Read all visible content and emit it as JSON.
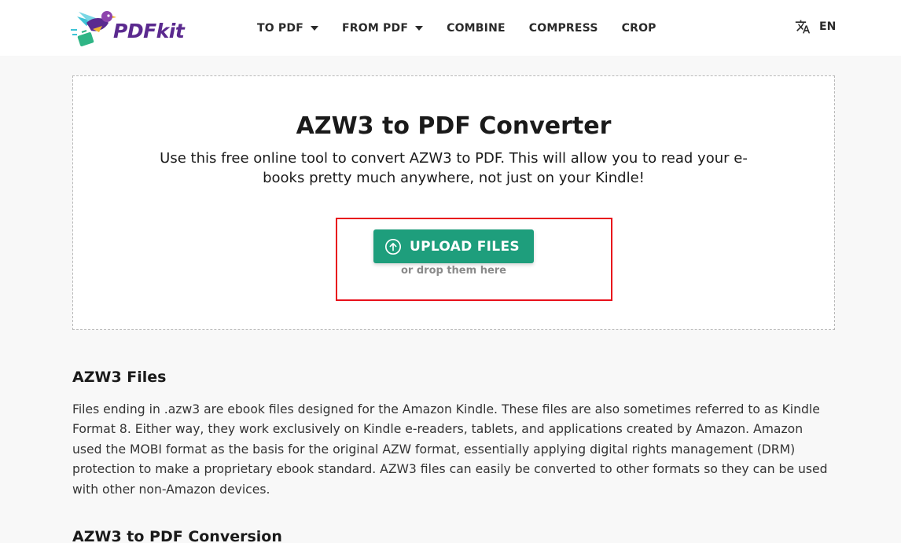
{
  "brand": {
    "name": "PDFkit"
  },
  "nav": {
    "items": [
      {
        "label": "TO PDF",
        "dropdown": true
      },
      {
        "label": "FROM PDF",
        "dropdown": true
      },
      {
        "label": "COMBINE",
        "dropdown": false
      },
      {
        "label": "COMPRESS",
        "dropdown": false
      },
      {
        "label": "CROP",
        "dropdown": false
      }
    ],
    "language": "EN"
  },
  "hero": {
    "title": "AZW3 to PDF Converter",
    "description": "Use this free online tool to convert AZW3 to PDF. This will allow you to read your e-books pretty much anywhere, not just on your Kindle!",
    "upload_label": "UPLOAD FILES",
    "drop_hint": "or drop them here"
  },
  "sections": [
    {
      "title": "AZW3 Files",
      "body": "Files ending in .azw3 are ebook files designed for the Amazon Kindle. These files are also sometimes referred to as Kindle Format 8. Either way, they work exclusively on Kindle e-readers, tablets, and applications created by Amazon. Amazon used the MOBI format as the basis for the original AZW format, essentially applying digital rights management (DRM) protection to make a proprietary ebook standard. AZW3 files can easily be converted to other formats so they can be used with other non-Amazon devices."
    },
    {
      "title": "AZW3 to PDF Conversion"
    }
  ],
  "colors": {
    "accent": "#1e9e7c",
    "brand": "#5b2a8f",
    "highlight": "#e8101b"
  }
}
